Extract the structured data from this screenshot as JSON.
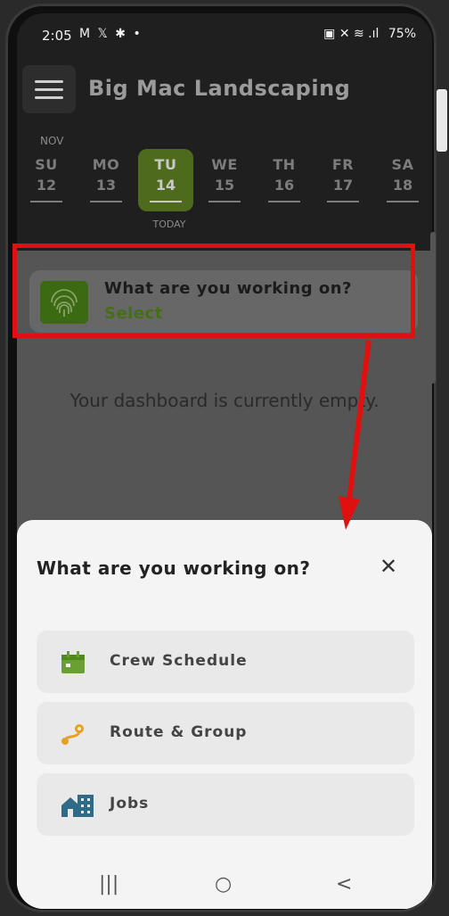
{
  "status_bar": {
    "time": "2:05",
    "notifications": "M 𝕏 ✱ •",
    "right_icons": "▣ ✕ ≋ .ıl",
    "battery": "75%"
  },
  "header": {
    "title": "Big Mac Landscaping"
  },
  "calendar": {
    "month": "NOV",
    "today_label": "TODAY",
    "days": [
      {
        "name": "SU",
        "date": "12"
      },
      {
        "name": "MO",
        "date": "13"
      },
      {
        "name": "TU",
        "date": "14"
      },
      {
        "name": "WE",
        "date": "15"
      },
      {
        "name": "TH",
        "date": "16"
      },
      {
        "name": "FR",
        "date": "17"
      },
      {
        "name": "SA",
        "date": "18"
      }
    ],
    "selected_index": 2
  },
  "dashboard": {
    "work_question": "What are you working on?",
    "select_label": "Select",
    "empty_message": "Your dashboard is currently empty."
  },
  "sheet": {
    "title": "What are you working on?",
    "close_glyph": "✕",
    "options": [
      {
        "label": "Crew Schedule",
        "icon": "calendar-icon",
        "color": "#6aa033"
      },
      {
        "label": "Route & Group",
        "icon": "route-icon",
        "color": "#e6a21a"
      },
      {
        "label": "Jobs",
        "icon": "buildings-icon",
        "color": "#2f6b86"
      }
    ]
  },
  "nav_bar": {
    "recents": "|||",
    "home": "○",
    "back": "<"
  },
  "colors": {
    "accent_green": "#4d6a1d",
    "highlight_red": "#e01010"
  }
}
